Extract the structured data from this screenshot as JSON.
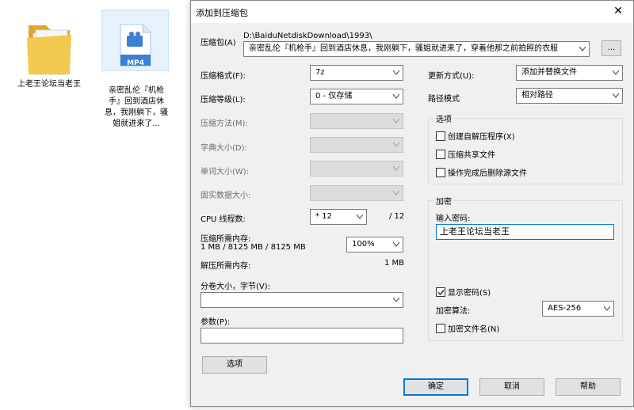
{
  "desktop": {
    "folder_label": "上老王论坛当老王",
    "video_label": "亲密乱伦『机枪手』回到酒店休息，我刚躺下，骚姐就进来了...",
    "video_badge": "MP4"
  },
  "dialog": {
    "title": "添加到压缩包",
    "close_icon": "close-icon",
    "archive_label": "压缩包(A)",
    "archive_path": "D:\\BaiduNetdiskDownload\\1993\\",
    "archive_name": "亲密乱伦『机枪手』回到酒店休息，我刚躺下，骚姐就进来了，穿着他那之前拍照的衣服",
    "browse_label": "...",
    "format_label": "压缩格式(F):",
    "format_value": "7z",
    "level_label": "压缩等级(L):",
    "level_value": "0 - 仅存储",
    "method_label": "压缩方法(M):",
    "dict_label": "字典大小(D):",
    "word_label": "单词大小(W):",
    "solid_label": "固实数据大小:",
    "cpu_label": "CPU 线程数:",
    "cpu_value": "* 12",
    "cpu_total": "/ 12",
    "mem_compress_label": "压缩所需内存:",
    "mem_compress_value": "1 MB / 8125 MB / 8125 MB",
    "mem_percent": "100%",
    "mem_decompress_label": "解压所需内存:",
    "mem_decompress_value": "1 MB",
    "split_label": "分卷大小，字节(V):",
    "params_label": "参数(P):",
    "options_button": "选项",
    "update_label": "更新方式(U):",
    "update_value": "添加并替换文件",
    "path_label": "路径模式",
    "path_value": "相对路径",
    "options_group": "选项",
    "opt_sfx": "创建自解压程序(X)",
    "opt_shared": "压缩共享文件",
    "opt_delete": "操作完成后删除源文件",
    "encrypt_group": "加密",
    "password_label": "输入密码:",
    "password_value": "上老王论坛当老王",
    "show_password": "显示密码(S)",
    "enc_method_label": "加密算法:",
    "enc_method_value": "AES-256",
    "encrypt_names": "加密文件名(N)",
    "ok": "确定",
    "cancel": "取消",
    "help": "帮助"
  }
}
